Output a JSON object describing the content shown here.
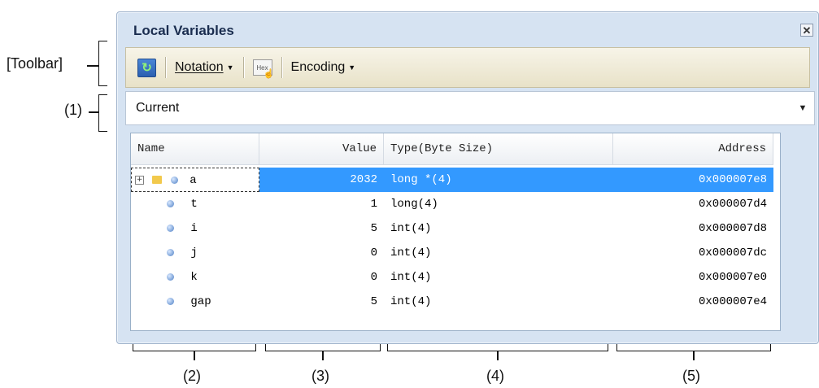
{
  "window": {
    "title": "Local Variables",
    "close_glyph": "✕"
  },
  "toolbar": {
    "refresh_icon": "refresh-icon",
    "notation_label": "Notation",
    "hex_label": "Hex",
    "encoding_label": "Encoding"
  },
  "scope": {
    "value": "Current"
  },
  "grid": {
    "columns": [
      "Name",
      "Value",
      "Type(Byte Size)",
      "Address"
    ],
    "rows": [
      {
        "name": "a",
        "value": "2032",
        "type": "long *(4)",
        "address": "0x000007e8"
      },
      {
        "name": "t",
        "value": "1",
        "type": "long(4)",
        "address": "0x000007d4"
      },
      {
        "name": "i",
        "value": "5",
        "type": "int(4)",
        "address": "0x000007d8"
      },
      {
        "name": "j",
        "value": "0",
        "type": "int(4)",
        "address": "0x000007dc"
      },
      {
        "name": "k",
        "value": "0",
        "type": "int(4)",
        "address": "0x000007e0"
      },
      {
        "name": "gap",
        "value": "5",
        "type": "int(4)",
        "address": "0x000007e4"
      }
    ]
  },
  "annotations": {
    "toolbar": "[Toolbar]",
    "one": "(1)",
    "two": "(2)",
    "three": "(3)",
    "four": "(4)",
    "five": "(5)"
  },
  "colors": {
    "selection": "#3399ff",
    "toolbar_bg": "#f2eedc",
    "window_frame": "#d6e3f2"
  }
}
